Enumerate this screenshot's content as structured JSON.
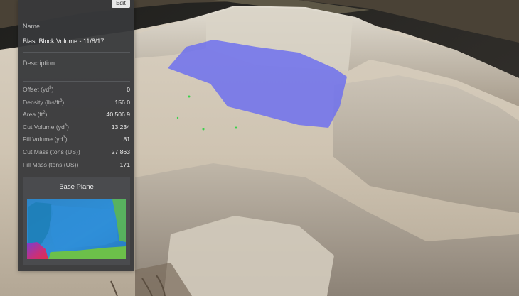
{
  "panel": {
    "edit_label": "Edit",
    "name_label": "Name",
    "name_value": "Blast Block Volume - 11/8/17",
    "description_label": "Description",
    "stats": [
      {
        "label": "Offset",
        "unit": "yd",
        "sup": "3",
        "tail": ")",
        "value": "0"
      },
      {
        "label": "Density",
        "unit": "lbs/ft",
        "sup": "3",
        "tail": ")",
        "value": "156.0"
      },
      {
        "label": "Area",
        "unit": "ft",
        "sup": "2",
        "tail": ")",
        "value": "40,506.9"
      },
      {
        "label": "Cut Volume",
        "unit": "yd",
        "sup": "3",
        "tail": ")",
        "value": "13,234"
      },
      {
        "label": "Fill Volume",
        "unit": "yd",
        "sup": "3",
        "tail": ")",
        "value": "81"
      },
      {
        "label": "Cut Mass",
        "unit": "tons (US)",
        "sup": "",
        "tail": ")",
        "value": "27,863"
      },
      {
        "label": "Fill Mass",
        "unit": "tons (US)",
        "sup": "",
        "tail": ")",
        "value": "171"
      }
    ],
    "base_plane_label": "Base Plane"
  },
  "colors": {
    "panel_bg": "#38393b",
    "volume_overlay": "#6a6cf0",
    "heatmap_blue": "#2f8fd8",
    "heatmap_green": "#6cc04a",
    "heatmap_red": "#e0304a"
  }
}
